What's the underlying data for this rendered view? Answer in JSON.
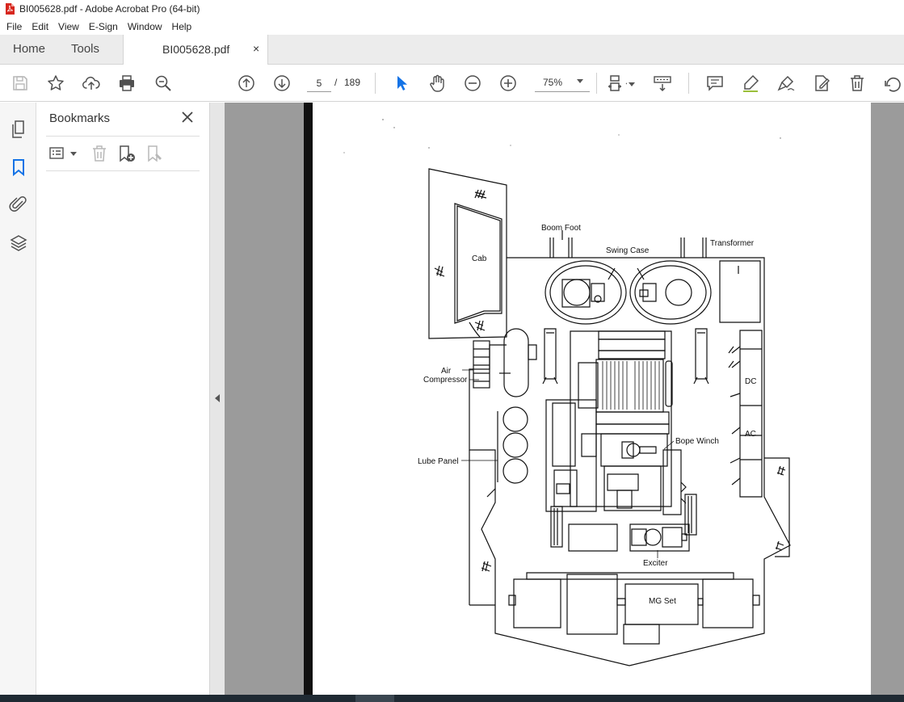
{
  "window": {
    "title": "BI005628.pdf - Adobe Acrobat Pro (64-bit)"
  },
  "menu": [
    "File",
    "Edit",
    "View",
    "E-Sign",
    "Window",
    "Help"
  ],
  "nav_tabs": {
    "home": "Home",
    "tools": "Tools"
  },
  "doc_tab": {
    "name": "BI005628.pdf",
    "close": "×"
  },
  "toolbar": {
    "page_current": "5",
    "page_separator": "/",
    "page_total": "189",
    "zoom": "75%",
    "icons": [
      "save-icon",
      "star-icon",
      "upload-icon",
      "print-icon",
      "zoom-search-icon",
      "page-up-icon",
      "page-down-icon",
      "select-arrow-icon",
      "hand-icon",
      "zoom-out-icon",
      "zoom-in-icon",
      "fit-page-icon",
      "scroll-mode-icon",
      "comment-icon",
      "highlight-icon",
      "sign-icon",
      "fill-sign-icon",
      "delete-icon",
      "rotate-icon"
    ]
  },
  "sidebar": {
    "rail_icons": [
      "pages-icon",
      "bookmark-icon",
      "attachment-icon",
      "layers-icon"
    ],
    "bookmarks_title": "Bookmarks",
    "bookmark_tools": [
      "options-icon",
      "delete-bookmark-icon",
      "new-bookmark-icon",
      "new-from-structure-icon"
    ]
  },
  "diagram_labels": {
    "boom_foot": "Boom Foot",
    "swing_case": "Swing Case",
    "transformer": "Transformer",
    "cab": "Cab",
    "air_compressor_1": "Air",
    "air_compressor_2": "Compressor",
    "dc": "DC",
    "ac": "AC",
    "rope_winch": "Bope Winch",
    "lube_panel": "Lube Panel",
    "exciter": "Exciter",
    "mg_set": "MG Set"
  },
  "colors": {
    "accent_blue": "#1473e6",
    "icon_gray": "#505050",
    "panel_bg": "#ececec",
    "viewer_bg": "#9b9b9b"
  }
}
